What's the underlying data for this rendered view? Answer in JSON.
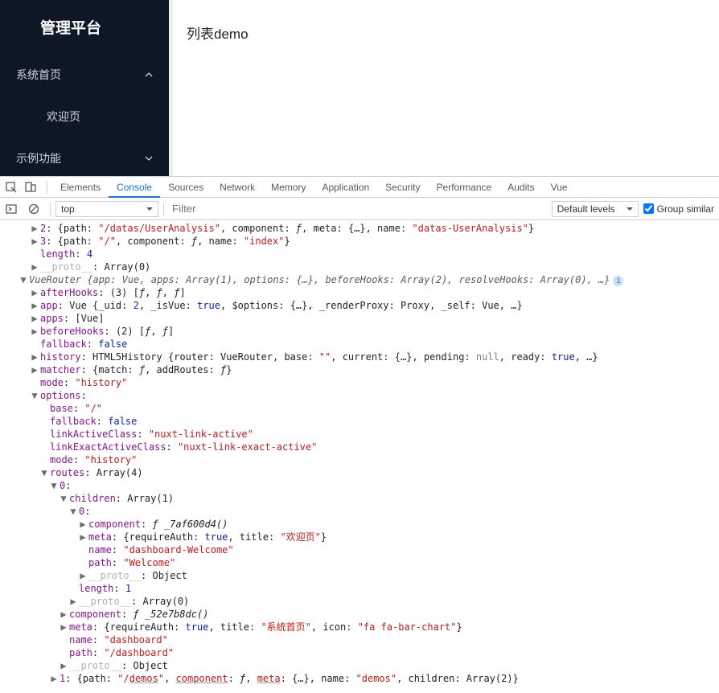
{
  "sidebar": {
    "title": "管理平台",
    "items": [
      {
        "label": "系统首页",
        "expanded": true
      },
      {
        "sub": true,
        "label": "欢迎页"
      },
      {
        "label": "示例功能",
        "expanded": false
      }
    ]
  },
  "main": {
    "heading": "列表demo"
  },
  "devtools": {
    "tabs": [
      "Elements",
      "Console",
      "Sources",
      "Network",
      "Memory",
      "Application",
      "Security",
      "Performance",
      "Audits",
      "Vue"
    ],
    "active_tab": "Console",
    "context": "top",
    "filter_placeholder": "Filter",
    "levels": "Default levels",
    "group_similar": "Group similar",
    "group_similar_checked": true
  },
  "console": {
    "lines": [
      {
        "ind": 1,
        "arrow": "▶",
        "tokens": [
          [
            "key",
            "2"
          ],
          [
            "obj",
            ": {path: "
          ],
          [
            "str",
            "\"/datas/UserAnalysis\""
          ],
          [
            "obj",
            ", component: "
          ],
          [
            "fn",
            "ƒ"
          ],
          [
            "obj",
            ", meta: {…}, name: "
          ],
          [
            "str",
            "\"datas-UserAnalysis\""
          ],
          [
            "obj",
            "}"
          ]
        ]
      },
      {
        "ind": 1,
        "arrow": "▶",
        "tokens": [
          [
            "key",
            "3"
          ],
          [
            "obj",
            ": {path: "
          ],
          [
            "str",
            "\"/\""
          ],
          [
            "obj",
            ", component: "
          ],
          [
            "fn",
            "ƒ"
          ],
          [
            "obj",
            ", name: "
          ],
          [
            "str",
            "\"index\""
          ],
          [
            "obj",
            "}"
          ]
        ]
      },
      {
        "ind": 1,
        "arrow": "",
        "tokens": [
          [
            "key",
            "length"
          ],
          [
            "obj",
            ": "
          ],
          [
            "num",
            "4"
          ]
        ]
      },
      {
        "ind": 1,
        "arrow": "▶",
        "tokens": [
          [
            "proto",
            "__proto__"
          ],
          [
            "obj",
            ": Array(0)"
          ]
        ]
      },
      {
        "ind": 0,
        "arrow": "▼",
        "vr": "VueRouter {app: Vue, apps: Array(1), options: {…}, beforeHooks: Array(2), resolveHooks: Array(0), …}",
        "info": true
      },
      {
        "ind": 1,
        "arrow": "▶",
        "tokens": [
          [
            "key",
            "afterHooks"
          ],
          [
            "obj",
            ": (3) ["
          ],
          [
            "fn",
            "ƒ"
          ],
          [
            "obj",
            ", "
          ],
          [
            "fn",
            "ƒ"
          ],
          [
            "obj",
            ", "
          ],
          [
            "fn",
            "ƒ"
          ],
          [
            "obj",
            "]"
          ]
        ]
      },
      {
        "ind": 1,
        "arrow": "▶",
        "tokens": [
          [
            "key",
            "app"
          ],
          [
            "obj",
            ": Vue {_uid: "
          ],
          [
            "num",
            "2"
          ],
          [
            "obj",
            ", _isVue: "
          ],
          [
            "bool",
            "true"
          ],
          [
            "obj",
            ", $options: {…}, _renderProxy: Proxy, _self: Vue, …}"
          ]
        ]
      },
      {
        "ind": 1,
        "arrow": "▶",
        "tokens": [
          [
            "key",
            "apps"
          ],
          [
            "obj",
            ": [Vue]"
          ]
        ]
      },
      {
        "ind": 1,
        "arrow": "▶",
        "tokens": [
          [
            "key",
            "beforeHooks"
          ],
          [
            "obj",
            ": (2) ["
          ],
          [
            "fn",
            "ƒ"
          ],
          [
            "obj",
            ", "
          ],
          [
            "fn",
            "ƒ"
          ],
          [
            "obj",
            "]"
          ]
        ]
      },
      {
        "ind": 1,
        "arrow": "",
        "tokens": [
          [
            "key",
            "fallback"
          ],
          [
            "obj",
            ": "
          ],
          [
            "bool",
            "false"
          ]
        ]
      },
      {
        "ind": 1,
        "arrow": "▶",
        "tokens": [
          [
            "key",
            "history"
          ],
          [
            "obj",
            ": HTML5History {router: VueRouter, base: "
          ],
          [
            "str",
            "\"\""
          ],
          [
            "obj",
            ", current: {…}, pending: "
          ],
          [
            "nul",
            "null"
          ],
          [
            "obj",
            ", ready: "
          ],
          [
            "bool",
            "true"
          ],
          [
            "obj",
            ", …}"
          ]
        ]
      },
      {
        "ind": 1,
        "arrow": "▶",
        "tokens": [
          [
            "key",
            "matcher"
          ],
          [
            "obj",
            ": {match: "
          ],
          [
            "fn",
            "ƒ"
          ],
          [
            "obj",
            ", addRoutes: "
          ],
          [
            "fn",
            "ƒ"
          ],
          [
            "obj",
            "}"
          ]
        ]
      },
      {
        "ind": 1,
        "arrow": "",
        "tokens": [
          [
            "key",
            "mode"
          ],
          [
            "obj",
            ": "
          ],
          [
            "str",
            "\"history\""
          ]
        ]
      },
      {
        "ind": 1,
        "arrow": "▼",
        "tokens": [
          [
            "key",
            "options"
          ],
          [
            "obj",
            ":"
          ]
        ]
      },
      {
        "ind": 2,
        "arrow": "",
        "tokens": [
          [
            "key",
            "base"
          ],
          [
            "obj",
            ": "
          ],
          [
            "str",
            "\"/\""
          ]
        ]
      },
      {
        "ind": 2,
        "arrow": "",
        "tokens": [
          [
            "key",
            "fallback"
          ],
          [
            "obj",
            ": "
          ],
          [
            "bool",
            "false"
          ]
        ]
      },
      {
        "ind": 2,
        "arrow": "",
        "tokens": [
          [
            "key",
            "linkActiveClass"
          ],
          [
            "obj",
            ": "
          ],
          [
            "str",
            "\"nuxt-link-active\""
          ]
        ]
      },
      {
        "ind": 2,
        "arrow": "",
        "tokens": [
          [
            "key",
            "linkExactActiveClass"
          ],
          [
            "obj",
            ": "
          ],
          [
            "str",
            "\"nuxt-link-exact-active\""
          ]
        ]
      },
      {
        "ind": 2,
        "arrow": "",
        "tokens": [
          [
            "key",
            "mode"
          ],
          [
            "obj",
            ": "
          ],
          [
            "str",
            "\"history\""
          ]
        ]
      },
      {
        "ind": 2,
        "arrow": "▼",
        "tokens": [
          [
            "key",
            "routes"
          ],
          [
            "obj",
            ": Array(4)"
          ]
        ]
      },
      {
        "ind": 3,
        "arrow": "▼",
        "tokens": [
          [
            "key",
            "0"
          ],
          [
            "obj",
            ":"
          ]
        ]
      },
      {
        "ind": 4,
        "arrow": "▼",
        "tokens": [
          [
            "key",
            "children"
          ],
          [
            "obj",
            ": Array(1)"
          ]
        ]
      },
      {
        "ind": 5,
        "arrow": "▼",
        "tokens": [
          [
            "key",
            "0"
          ],
          [
            "obj",
            ":"
          ]
        ]
      },
      {
        "ind": 6,
        "arrow": "▶",
        "tokens": [
          [
            "key",
            "component"
          ],
          [
            "obj",
            ": "
          ],
          [
            "fn",
            "ƒ _7af600d4()"
          ]
        ]
      },
      {
        "ind": 6,
        "arrow": "▶",
        "tokens": [
          [
            "key",
            "meta"
          ],
          [
            "obj",
            ": {requireAuth: "
          ],
          [
            "bool",
            "true"
          ],
          [
            "obj",
            ", title: "
          ],
          [
            "str",
            "\"欢迎页\""
          ],
          [
            "obj",
            "}"
          ]
        ]
      },
      {
        "ind": 6,
        "arrow": "",
        "tokens": [
          [
            "key",
            "name"
          ],
          [
            "obj",
            ": "
          ],
          [
            "str",
            "\"dashboard-Welcome\""
          ]
        ]
      },
      {
        "ind": 6,
        "arrow": "",
        "tokens": [
          [
            "key",
            "path"
          ],
          [
            "obj",
            ": "
          ],
          [
            "str",
            "\"Welcome\""
          ]
        ]
      },
      {
        "ind": 6,
        "arrow": "▶",
        "tokens": [
          [
            "proto",
            "__proto__"
          ],
          [
            "obj",
            ": Object"
          ]
        ]
      },
      {
        "ind": 5,
        "arrow": "",
        "tokens": [
          [
            "key",
            "length"
          ],
          [
            "obj",
            ": "
          ],
          [
            "num",
            "1"
          ]
        ]
      },
      {
        "ind": 5,
        "arrow": "▶",
        "tokens": [
          [
            "proto",
            "__proto__"
          ],
          [
            "obj",
            ": Array(0)"
          ]
        ]
      },
      {
        "ind": 4,
        "arrow": "▶",
        "tokens": [
          [
            "key",
            "component"
          ],
          [
            "obj",
            ": "
          ],
          [
            "fn",
            "ƒ _52e7b8dc()"
          ]
        ]
      },
      {
        "ind": 4,
        "arrow": "▶",
        "tokens": [
          [
            "key",
            "meta"
          ],
          [
            "obj",
            ": {requireAuth: "
          ],
          [
            "bool",
            "true"
          ],
          [
            "obj",
            ", title: "
          ],
          [
            "str",
            "\"系统首页\""
          ],
          [
            "obj",
            ", icon: "
          ],
          [
            "str",
            "\"fa fa-bar-chart\""
          ],
          [
            "obj",
            "}"
          ]
        ]
      },
      {
        "ind": 4,
        "arrow": "",
        "tokens": [
          [
            "key",
            "name"
          ],
          [
            "obj",
            ": "
          ],
          [
            "str",
            "\"dashboard\""
          ]
        ]
      },
      {
        "ind": 4,
        "arrow": "",
        "tokens": [
          [
            "key",
            "path"
          ],
          [
            "obj",
            ": "
          ],
          [
            "str",
            "\"/dashboard\""
          ]
        ]
      },
      {
        "ind": 4,
        "arrow": "▶",
        "tokens": [
          [
            "proto",
            "__proto__"
          ],
          [
            "obj",
            ": Object"
          ]
        ]
      },
      {
        "ind": 3,
        "arrow": "▶",
        "tokens": [
          [
            "key",
            "1"
          ],
          [
            "obj",
            ": {path: "
          ],
          [
            "str",
            "\"/"
          ],
          [
            "ul",
            "demos"
          ],
          [
            "str",
            "\""
          ],
          [
            "obj",
            ", "
          ],
          [
            "ul",
            "component"
          ],
          [
            "obj",
            ": "
          ],
          [
            "fn",
            "ƒ"
          ],
          [
            "obj",
            ", "
          ],
          [
            "ul",
            "meta"
          ],
          [
            "obj",
            ": {…}, name: "
          ],
          [
            "str",
            "\"demos\""
          ],
          [
            "obj",
            ", children: Array(2)}"
          ]
        ]
      }
    ]
  }
}
